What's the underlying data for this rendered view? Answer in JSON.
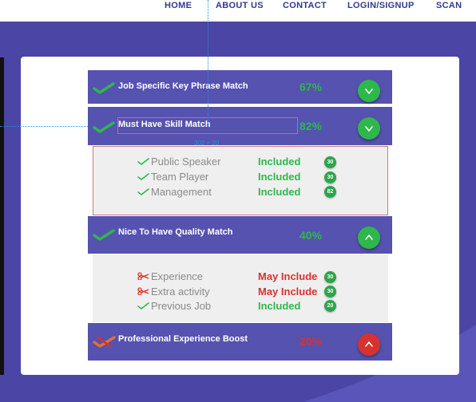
{
  "nav": {
    "items": [
      "HOME",
      "ABOUT US",
      "CONTACT",
      "LOGIN/SIGNUP",
      "SCAN"
    ]
  },
  "colors": {
    "header_bg": "#5552b0",
    "page_bg": "#4b45a6",
    "green": "#2eb84b",
    "red": "#d8322f",
    "badge": "#2da44a"
  },
  "overlay": {
    "dimension_label": "302 × 20"
  },
  "sections": [
    {
      "title": "Job Specific Key Phrase Match",
      "percent": "67%",
      "toggle_icon": "chevron-down-icon",
      "status_icon": "checkmark-icon"
    },
    {
      "title": "Must Have Skill Match",
      "percent": "82%",
      "toggle_icon": "chevron-down-icon",
      "status_icon": "checkmark-icon",
      "items": [
        {
          "label": "Public Speaker",
          "status": "Included",
          "score": "30",
          "icon": "checkmark-icon"
        },
        {
          "label": "Team Player",
          "status": "Included",
          "score": "30",
          "icon": "checkmark-icon"
        },
        {
          "label": "Management",
          "status": "Included",
          "score": "82",
          "icon": "checkmark-icon"
        }
      ]
    },
    {
      "title": "Nice To Have Quality Match",
      "percent": "40%",
      "toggle_icon": "chevron-up-icon",
      "status_icon": "checkmark-icon",
      "items": [
        {
          "label": "Experience",
          "status": "May Include",
          "score": "30",
          "icon": "scissors-icon"
        },
        {
          "label": "Extra activity",
          "status": "May Include",
          "score": "30",
          "icon": "scissors-icon"
        },
        {
          "label": "Previous Job",
          "status": "Included",
          "score": "20",
          "icon": "checkmark-icon"
        }
      ]
    },
    {
      "title": "Professional Experience Boost",
      "percent": "20%",
      "toggle_icon": "chevron-up-icon",
      "status_icon": "cross-check-icon"
    }
  ]
}
